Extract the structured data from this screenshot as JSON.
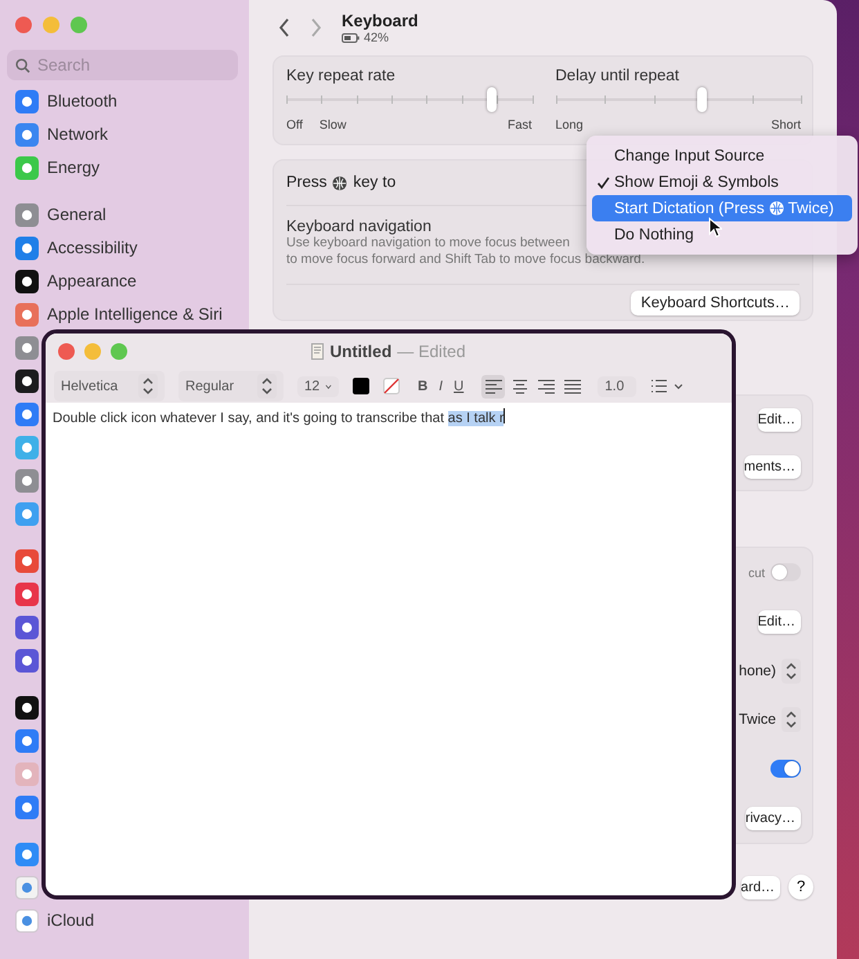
{
  "sidebar": {
    "search": {
      "placeholder": "Search"
    },
    "groups": [
      {
        "items": [
          {
            "label": "Bluetooth",
            "color": "#2f7cf6"
          },
          {
            "label": "Network",
            "color": "#3a86f0"
          },
          {
            "label": "Energy",
            "color": "#3cc84a"
          }
        ]
      },
      {
        "items": [
          {
            "label": "General",
            "color": "#8e8e93"
          },
          {
            "label": "Accessibility",
            "color": "#1f7fe8"
          },
          {
            "label": "Appearance",
            "color": "#111111"
          },
          {
            "label": "Apple Intelligence & Siri",
            "color": "#e8705a"
          },
          {
            "color": "#8e8e93"
          },
          {
            "color": "#1c1c1e"
          },
          {
            "color": "#2f7cf6"
          },
          {
            "color": "#3fb0e8"
          },
          {
            "color": "#8e8e93"
          },
          {
            "color": "#3fa0f0"
          }
        ]
      },
      {
        "items": [
          {
            "color": "#e84a3a"
          },
          {
            "color": "#e8354a"
          },
          {
            "color": "#5b56d6"
          },
          {
            "color": "#5b56d6"
          }
        ]
      },
      {
        "items": [
          {
            "color": "#111111"
          },
          {
            "color": "#2f7cf6"
          },
          {
            "color": "#e3b4bc"
          },
          {
            "color": "#2f7cf6"
          }
        ]
      },
      {
        "items": [
          {
            "color": "#2f8cf6"
          },
          {
            "color": "#f2f2f2"
          },
          {
            "label": "iCloud",
            "color": "#ffffff"
          }
        ]
      }
    ]
  },
  "header": {
    "title": "Keyboard",
    "battery": "42%"
  },
  "repeat_card": {
    "sliders": [
      {
        "label": "Key repeat rate",
        "level": 0.84,
        "min_labels": [
          "Off",
          "Slow"
        ],
        "max_label": "Fast"
      },
      {
        "label": "Delay until repeat",
        "level": 0.6,
        "min_labels": [
          "Long"
        ],
        "max_label": "Short"
      }
    ]
  },
  "globe_row": {
    "label_before": "Press",
    "label_after": "key to"
  },
  "navigation": {
    "title": "Keyboard navigation",
    "description_lines": [
      "Use keyboard navigation to move focus between",
      "to move focus forward and Shift Tab to move focus backward."
    ]
  },
  "shortcuts_button": "Keyboard Shortcuts…",
  "card_3": [
    {
      "kind": "button",
      "label": "Edit…"
    },
    {
      "kind": "button",
      "label": "ments…"
    }
  ],
  "card_4": [
    {
      "kind": "toggle",
      "label": "cut",
      "on": false
    },
    {
      "kind": "button",
      "label": "Edit…"
    },
    {
      "kind": "popup",
      "label": "hone)"
    },
    {
      "kind": "popup",
      "label": "Twice"
    },
    {
      "kind": "toggle",
      "on": true
    },
    {
      "kind": "button",
      "label": "rivacy…"
    }
  ],
  "footer": [
    {
      "kind": "button",
      "label": "ard…"
    },
    {
      "kind": "help",
      "label": "?"
    }
  ],
  "menu": {
    "items": [
      {
        "label": "Change Input Source",
        "checked": false,
        "selected": false
      },
      {
        "label": "Show Emoji & Symbols",
        "checked": true,
        "selected": false
      },
      {
        "label": "Start Dictation (Press",
        "suffix": "Twice)",
        "checked": false,
        "selected": true
      },
      {
        "label": "Do Nothing",
        "checked": false,
        "selected": false
      }
    ]
  },
  "textedit": {
    "title": "Untitled",
    "status": "— Edited",
    "toolbar": {
      "font_family": "Helvetica",
      "font_style": "Regular",
      "font_size": "12",
      "style_buttons": [
        "B",
        "I",
        "U"
      ],
      "alignment": [
        {
          "kind": "left",
          "selected": true
        },
        {
          "kind": "center",
          "selected": false
        },
        {
          "kind": "right",
          "selected": false
        },
        {
          "kind": "justify",
          "selected": false
        }
      ],
      "line_spacing": "1.0"
    },
    "body": {
      "text": "Double click icon whatever I say, and it's going to transcribe that ",
      "selected_text": "as I talk r"
    }
  }
}
